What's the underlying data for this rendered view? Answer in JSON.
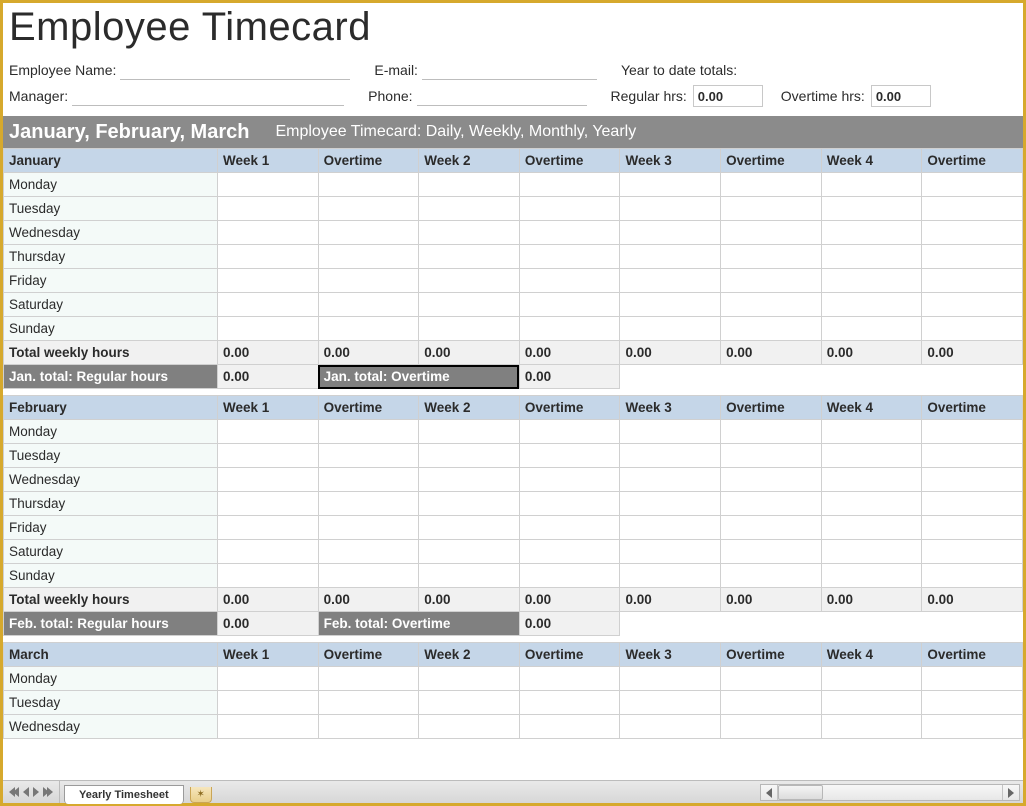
{
  "title": "Employee Timecard",
  "meta": {
    "emp_name_lbl": "Employee Name:",
    "email_lbl": "E-mail:",
    "ytd_lbl": "Year to date totals:",
    "manager_lbl": "Manager:",
    "phone_lbl": "Phone:",
    "regular_lbl": "Regular hrs:",
    "regular_val": "0.00",
    "overtime_lbl": "Overtime hrs:",
    "overtime_val": "0.00"
  },
  "quarter": {
    "title": "January, February, March",
    "sub": "Employee Timecard: Daily, Weekly, Monthly, Yearly"
  },
  "cols": [
    "Week 1",
    "Overtime",
    "Week 2",
    "Overtime",
    "Week 3",
    "Overtime",
    "Week 4",
    "Overtime"
  ],
  "days": [
    "Monday",
    "Tuesday",
    "Wednesday",
    "Thursday",
    "Friday",
    "Saturday",
    "Sunday"
  ],
  "tot_lbl": "Total weekly hours",
  "zeros": [
    "0.00",
    "0.00",
    "0.00",
    "0.00",
    "0.00",
    "0.00",
    "0.00",
    "0.00"
  ],
  "months": {
    "jan": {
      "name": "January",
      "mtot_reg_lbl": "Jan. total: Regular hours",
      "mtot_reg_val": "0.00",
      "mtot_ot_lbl": "Jan. total: Overtime",
      "mtot_ot_val": "0.00"
    },
    "feb": {
      "name": "February",
      "mtot_reg_lbl": "Feb. total: Regular hours",
      "mtot_reg_val": "0.00",
      "mtot_ot_lbl": "Feb.  total: Overtime",
      "mtot_ot_val": "0.00"
    },
    "mar": {
      "name": "March"
    }
  },
  "tabs": {
    "active": "Yearly Timesheet"
  }
}
